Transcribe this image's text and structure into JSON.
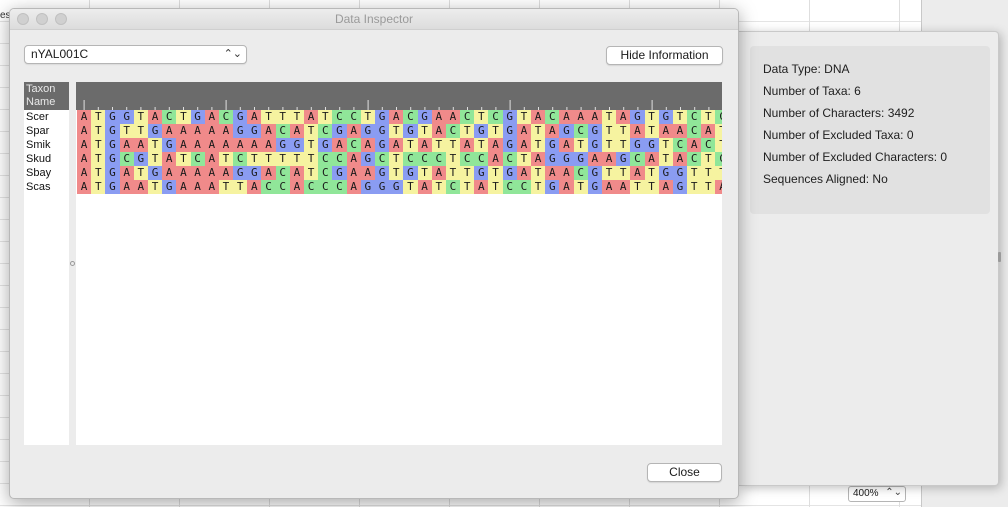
{
  "background_app": {
    "left_stub_text": "es",
    "zoom": "400%"
  },
  "dialog": {
    "title": "Data Inspector",
    "dataset_selector": {
      "selected": "nYAL001C"
    },
    "hide_info_label": "Hide Information",
    "close_label": "Close"
  },
  "info": {
    "data_type": "Data Type: DNA",
    "num_taxa": "Number of Taxa: 6",
    "num_characters": "Number of Characters: 3492",
    "excluded_taxa": "Number of Excluded Taxa: 0",
    "excluded_characters": "Number of Excluded Characters: 0",
    "aligned": "Sequences Aligned: No"
  },
  "alignment": {
    "taxon_header": "Taxon\nName",
    "taxa": [
      "Scer",
      "Spar",
      "Smik",
      "Skud",
      "Sbay",
      "Scas"
    ],
    "sequences": [
      "ATGGTACTGACGATTTATCCTGACGAACTCGTACAAATAGTGTCTC",
      "ATGTTGAAAAAGGACATCGAGGTGTACTGTGATAGCGTTATAACAT",
      "ATGAATGAAAAAAAGGTGACAGATATTATAGATGATGTTGGTCACT",
      "ATGCGTATCATCTTTTTCCAGCTCCCTCCACTAGGGAAGCATACTC",
      "ATGATGAAAAAGGACATCGAAGTGTATTGTGATAACGTTATGGTTT",
      "ATGAATGAAATTACCACCCAGGGTATCTATCCTGATGAATTAGTTA"
    ],
    "nucleotide_colors": {
      "A": "#f08a8a",
      "C": "#90e699",
      "G": "#8a9cf2",
      "T": "#f6f3a0"
    }
  }
}
